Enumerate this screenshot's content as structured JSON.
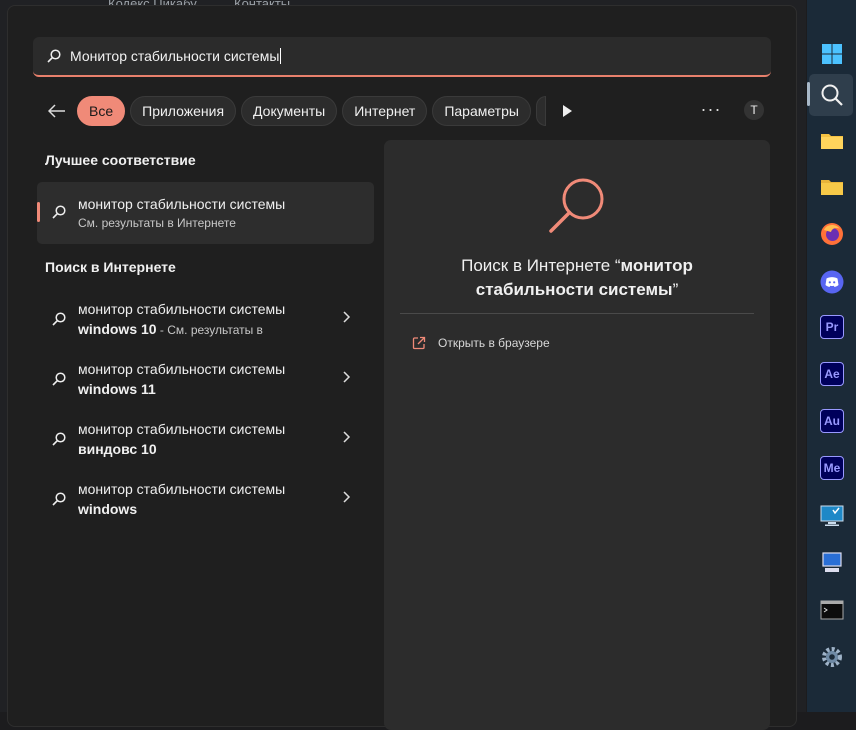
{
  "background": {
    "tabs": [
      "Кодекс Пикабу",
      "Контакты"
    ]
  },
  "search": {
    "value": "Монитор стабильности системы"
  },
  "filters": {
    "items": [
      "Все",
      "Приложения",
      "Документы",
      "Интернет",
      "Параметры"
    ],
    "avatar_letter": "T",
    "more": "···"
  },
  "best_match": {
    "section_title": "Лучшее соответствие",
    "title": "монитор стабильности системы",
    "subtitle": "См. результаты в Интернете"
  },
  "web_search": {
    "section_title": "Поиск в Интернете",
    "items": [
      {
        "line1": "монитор стабильности системы",
        "bold": "windows 10",
        "suffix": " - См. результаты в"
      },
      {
        "line1": "монитор стабильности системы",
        "bold": "windows 11",
        "suffix": ""
      },
      {
        "line1": "монитор стабильности системы",
        "bold": "виндовс 10",
        "suffix": ""
      },
      {
        "line1": "монитор стабильности системы",
        "bold": "windows",
        "suffix": ""
      }
    ]
  },
  "preview": {
    "title_prefix": "Поиск в Интернете “",
    "title_query_1": "монитор",
    "title_query_2": "стабильности системы",
    "title_suffix": "”",
    "open_browser": "Открыть в браузере"
  },
  "taskbar": {
    "items": [
      "windows-start",
      "search",
      "file-explorer",
      "folder",
      "firefox",
      "discord",
      "premiere-pro",
      "after-effects",
      "audition",
      "media-encoder",
      "remote-desktop",
      "computer",
      "terminal",
      "settings"
    ],
    "adobe_labels": {
      "pr": "Pr",
      "ae": "Ae",
      "au": "Au",
      "me": "Me"
    }
  },
  "colors": {
    "accent": "#f08a78",
    "panel": "#1f1f1f",
    "taskbar": "#1b2a38"
  }
}
